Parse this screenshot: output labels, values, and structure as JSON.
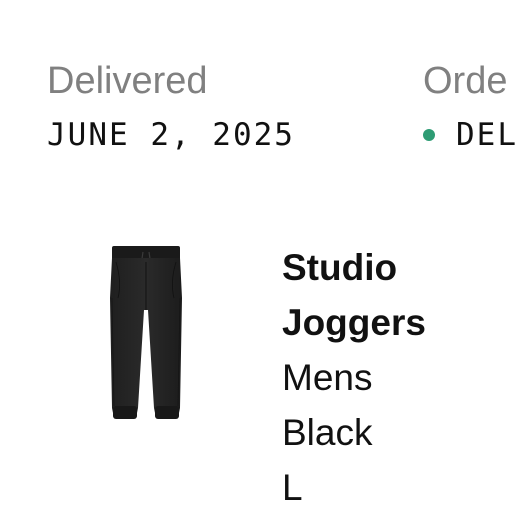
{
  "summary": {
    "delivered": {
      "label": "Delivered",
      "value": "JUNE 2, 2025"
    },
    "order": {
      "label": "Orde",
      "status": "DEL",
      "status_color": "#2e9c74"
    }
  },
  "item": {
    "name": "Studio Joggers",
    "name_line1": "Studio",
    "name_line2": "Joggers",
    "gender": "Mens",
    "color": "Black",
    "size": "L",
    "image_icon": "black-joggers-image"
  },
  "colors": {
    "label_gray": "#808080",
    "text": "#111111",
    "accent_green": "#2e9c74"
  }
}
